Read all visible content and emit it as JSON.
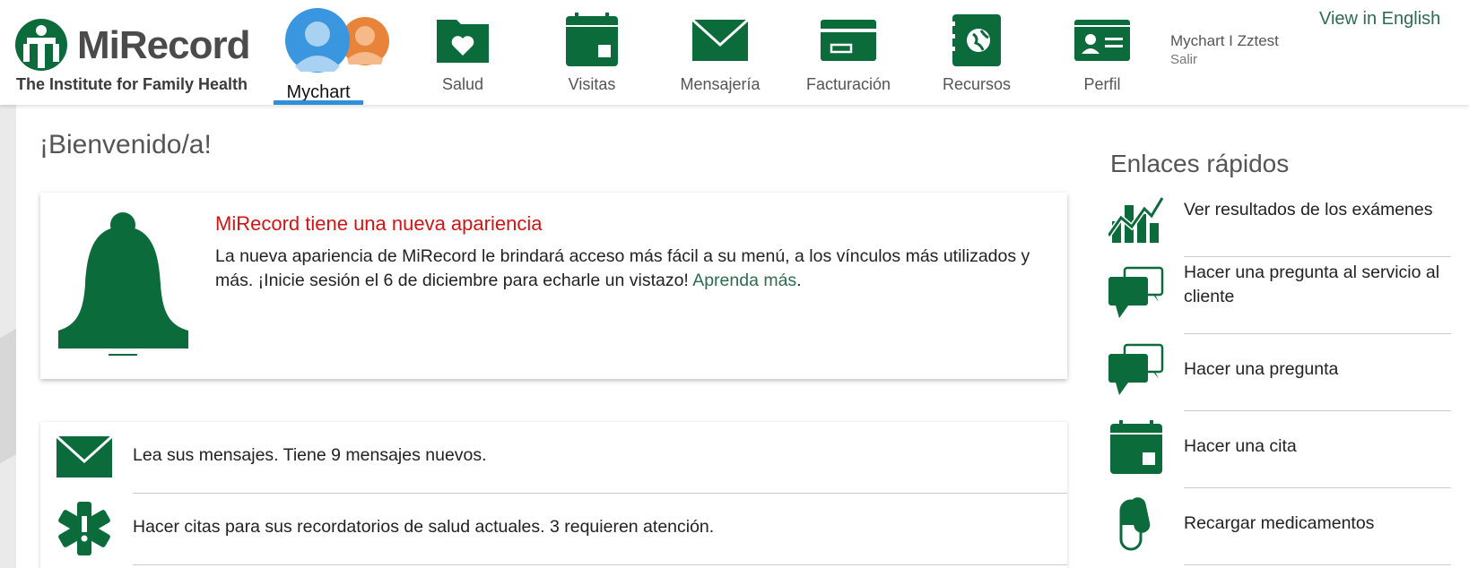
{
  "brand": {
    "name": "MiRecord",
    "subtitle": "The Institute for Family Health",
    "color": "#0b6b3a"
  },
  "nav": {
    "items": [
      {
        "label": "Mychart",
        "icon": "people-avatars-icon",
        "active": true
      },
      {
        "label": "Salud",
        "icon": "folder-heart-icon"
      },
      {
        "label": "Visitas",
        "icon": "calendar-icon"
      },
      {
        "label": "Mensajería",
        "icon": "envelope-icon"
      },
      {
        "label": "Facturación",
        "icon": "credit-card-icon"
      },
      {
        "label": "Recursos",
        "icon": "globe-book-icon"
      },
      {
        "label": "Perfil",
        "icon": "id-card-icon"
      }
    ]
  },
  "user": {
    "name": "Mychart I Zztest",
    "logout": "Salir"
  },
  "language_link": "View in English",
  "main": {
    "welcome": "¡Bienvenido/a!",
    "alert": {
      "title": "MiRecord tiene una nueva apariencia",
      "body": "La nueva apariencia de MiRecord le brindará acceso más fácil a su menú, a los vínculos más utilizados y más. ¡Inicie sesión el 6 de diciembre para echarle un vistazo!",
      "link": "Aprenda más",
      "period": "."
    },
    "list": [
      {
        "text": "Lea sus mensajes. Tiene 9 mensajes nuevos.",
        "icon": "envelope-icon"
      },
      {
        "text": "Hacer citas para sus recordatorios de salud actuales. 3 requieren atención.",
        "icon": "medical-star-icon"
      }
    ]
  },
  "quick_links": {
    "title": "Enlaces rápidos",
    "items": [
      {
        "label": "Ver resultados de los exámenes",
        "icon": "chart-results-icon"
      },
      {
        "label": "Hacer una pregunta al servicio al cliente",
        "icon": "chat-bubbles-icon"
      },
      {
        "label": "Hacer una pregunta",
        "icon": "chat-bubbles-icon"
      },
      {
        "label": "Hacer una cita",
        "icon": "calendar-icon"
      },
      {
        "label": "Recargar medicamentos",
        "icon": "pill-icon"
      }
    ]
  }
}
